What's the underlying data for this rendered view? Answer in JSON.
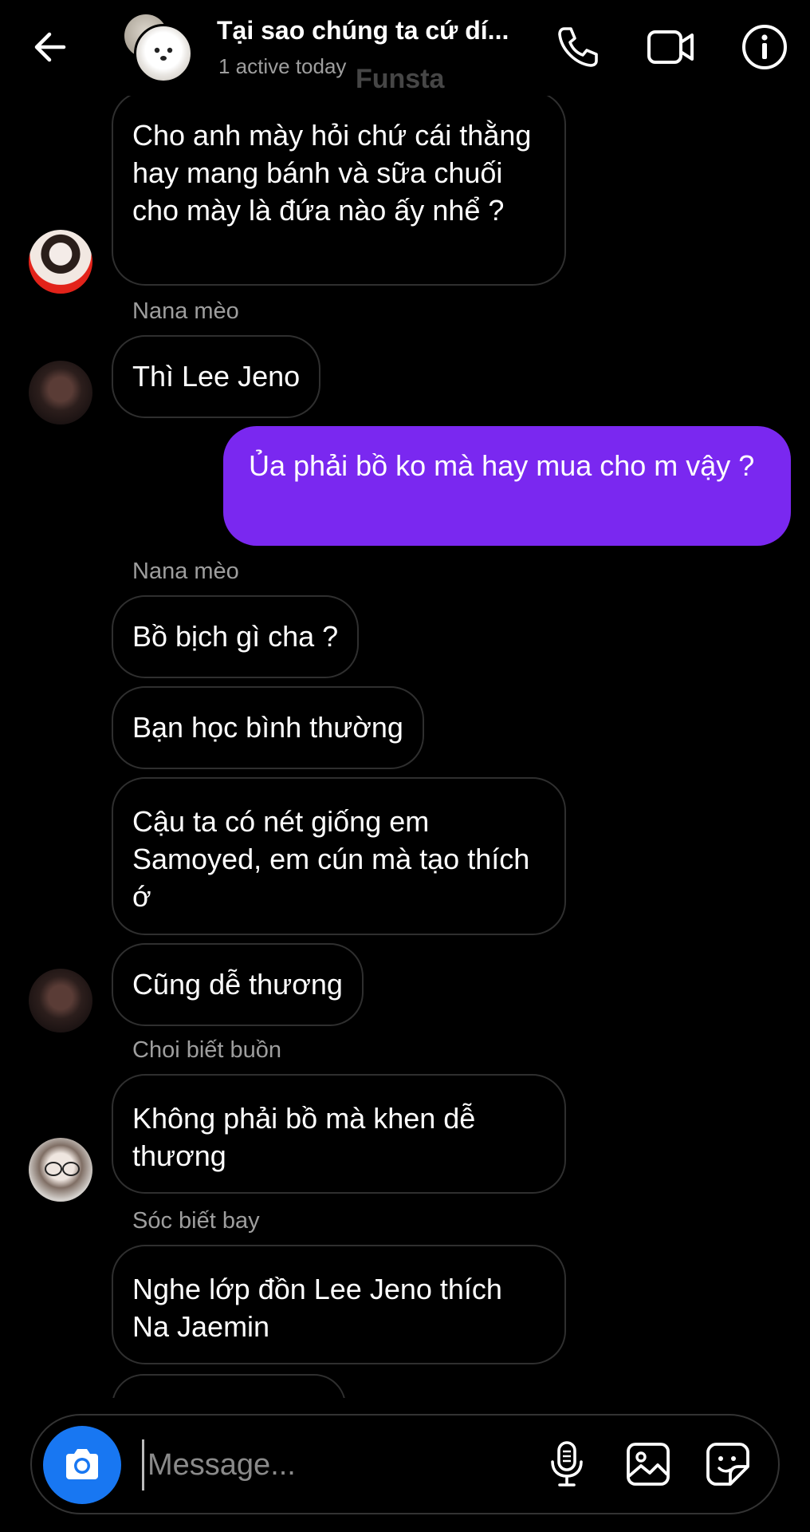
{
  "header": {
    "title": "Tại sao chúng ta cứ dí...",
    "subtitle": "1 active today",
    "watermark": "Funsta"
  },
  "messages": [
    {
      "text": "Cho anh mày hỏi chứ cái thằng hay mang bánh và sữa chuối cho mày là đứa nào ấy nhể ?"
    },
    {
      "sender": "Nana mèo"
    },
    {
      "text": "Thì Lee Jeno"
    },
    {
      "text": "Ủa phải bồ ko mà hay mua cho m vậy ?",
      "mine": true
    },
    {
      "sender": "Nana mèo"
    },
    {
      "text": "Bồ bịch gì cha ?"
    },
    {
      "text": "Bạn học bình thường"
    },
    {
      "text": "Cậu ta có nét giống em Samoyed, em cún mà tạo thích ớ"
    },
    {
      "text": "Cũng dễ thương"
    },
    {
      "sender": "Choi biết buồn"
    },
    {
      "text": "Không phải bồ mà khen dễ thương"
    },
    {
      "sender": "Sóc biết bay"
    },
    {
      "text": "Nghe lớp đồn Lee Jeno thích Na Jaemin"
    }
  ],
  "composer": {
    "placeholder": "Message..."
  },
  "colors": {
    "background": "#000000",
    "my_bubble": "#7a28f0",
    "camera_button": "#1877f2",
    "muted_text": "#9e9e9e"
  },
  "icons": [
    "back-arrow-icon",
    "phone-icon",
    "video-camera-icon",
    "info-icon",
    "camera-icon",
    "microphone-icon",
    "gallery-icon",
    "sticker-icon"
  ]
}
